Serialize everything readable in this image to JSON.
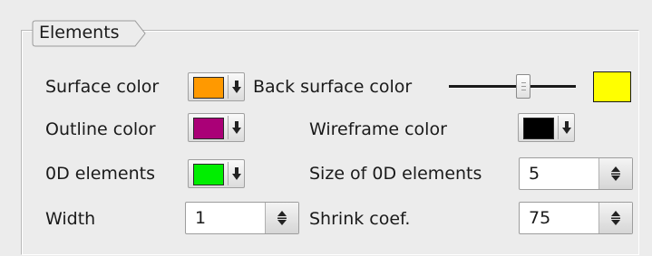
{
  "group": {
    "title": "Elements"
  },
  "surface": {
    "label": "Surface color",
    "color": "#ff9900"
  },
  "back_surface": {
    "label": "Back surface color",
    "slider_fraction": 0.6,
    "color": "#ffff00"
  },
  "outline": {
    "label": "Outline color",
    "color": "#aa0077"
  },
  "wireframe": {
    "label": "Wireframe color",
    "color": "#000000"
  },
  "elements_0d": {
    "label": "0D elements",
    "color": "#00ee00"
  },
  "size_0d": {
    "label": "Size of 0D elements",
    "value": "5"
  },
  "width": {
    "label": "Width",
    "value": "1"
  },
  "shrink": {
    "label": "Shrink coef.",
    "value": "75"
  },
  "icons": {
    "dropdown": "arrow-down-icon",
    "spin": "spin-arrows-icon"
  }
}
